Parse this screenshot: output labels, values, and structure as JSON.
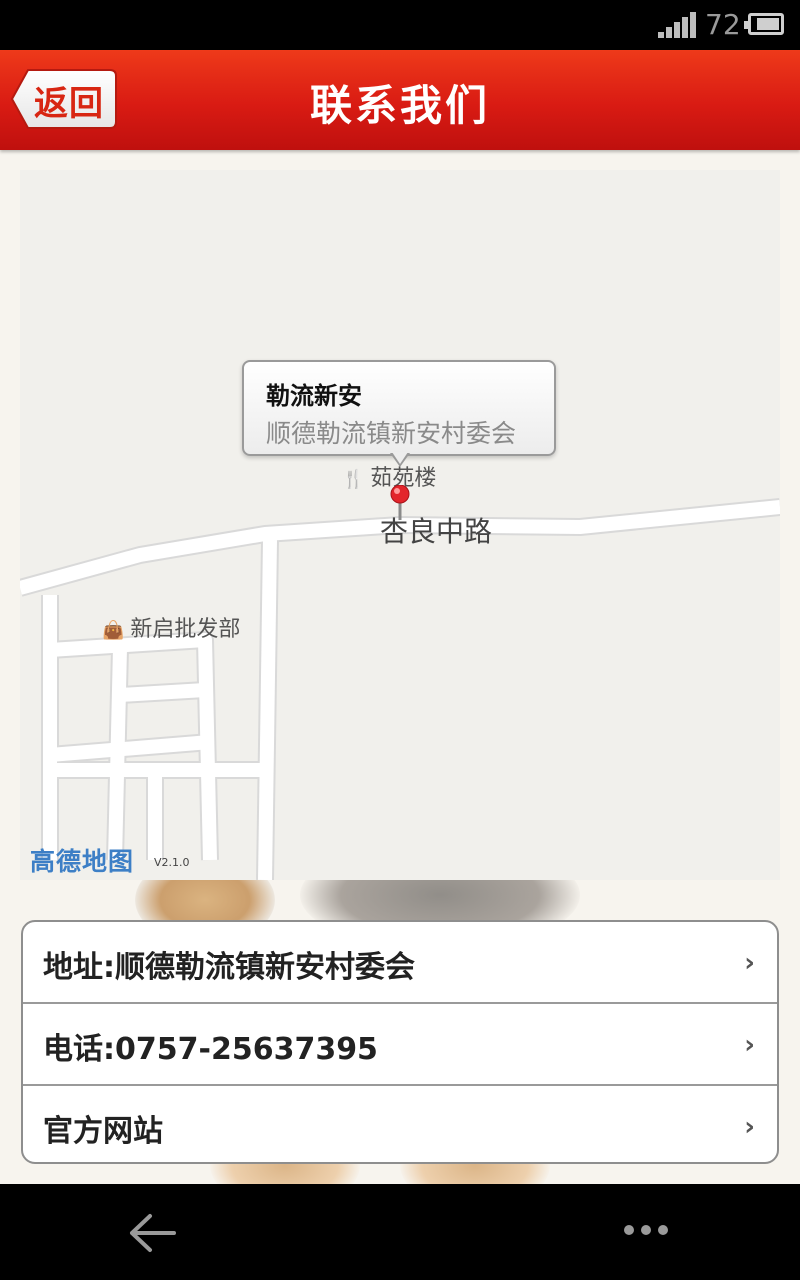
{
  "status_bar": {
    "battery_level": "72",
    "signal_bars": 5
  },
  "header": {
    "back_label": "返回",
    "title": "联系我们"
  },
  "map": {
    "callout_title": "勒流新安",
    "callout_subtitle": "顺德勒流镇新安村委会",
    "poi_restaurant": "茹苑楼",
    "poi_shop": "新启批发部",
    "road_label": "杏良中路",
    "provider_logo": "高德地图",
    "provider_version": "V2.1.0"
  },
  "info": {
    "address": "地址:顺德勒流镇新安村委会",
    "phone": "电话:0757-25637395",
    "website": "官方网站"
  },
  "colors": {
    "header_red": "#d91b13",
    "map_bg": "#f1f0ec",
    "link_blue": "#3d7fc6"
  }
}
